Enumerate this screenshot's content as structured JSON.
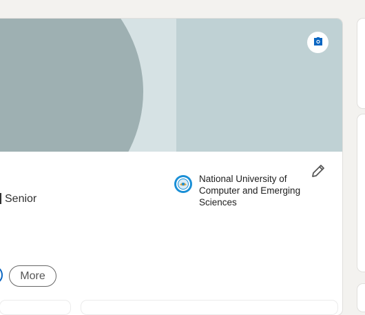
{
  "profile": {
    "headline_partial": "Senior",
    "education": {
      "name": "National University of Computer and Emerging Sciences"
    },
    "actions": {
      "more_label": "More"
    }
  },
  "icons": {
    "camera": "camera-icon",
    "edit": "pencil-icon",
    "university_logo": "university-logo"
  },
  "colors": {
    "accent": "#0a66c2",
    "banner": "#bfd1d4",
    "banner_dark": "#9eb0b2",
    "background": "#f3f2ef"
  }
}
